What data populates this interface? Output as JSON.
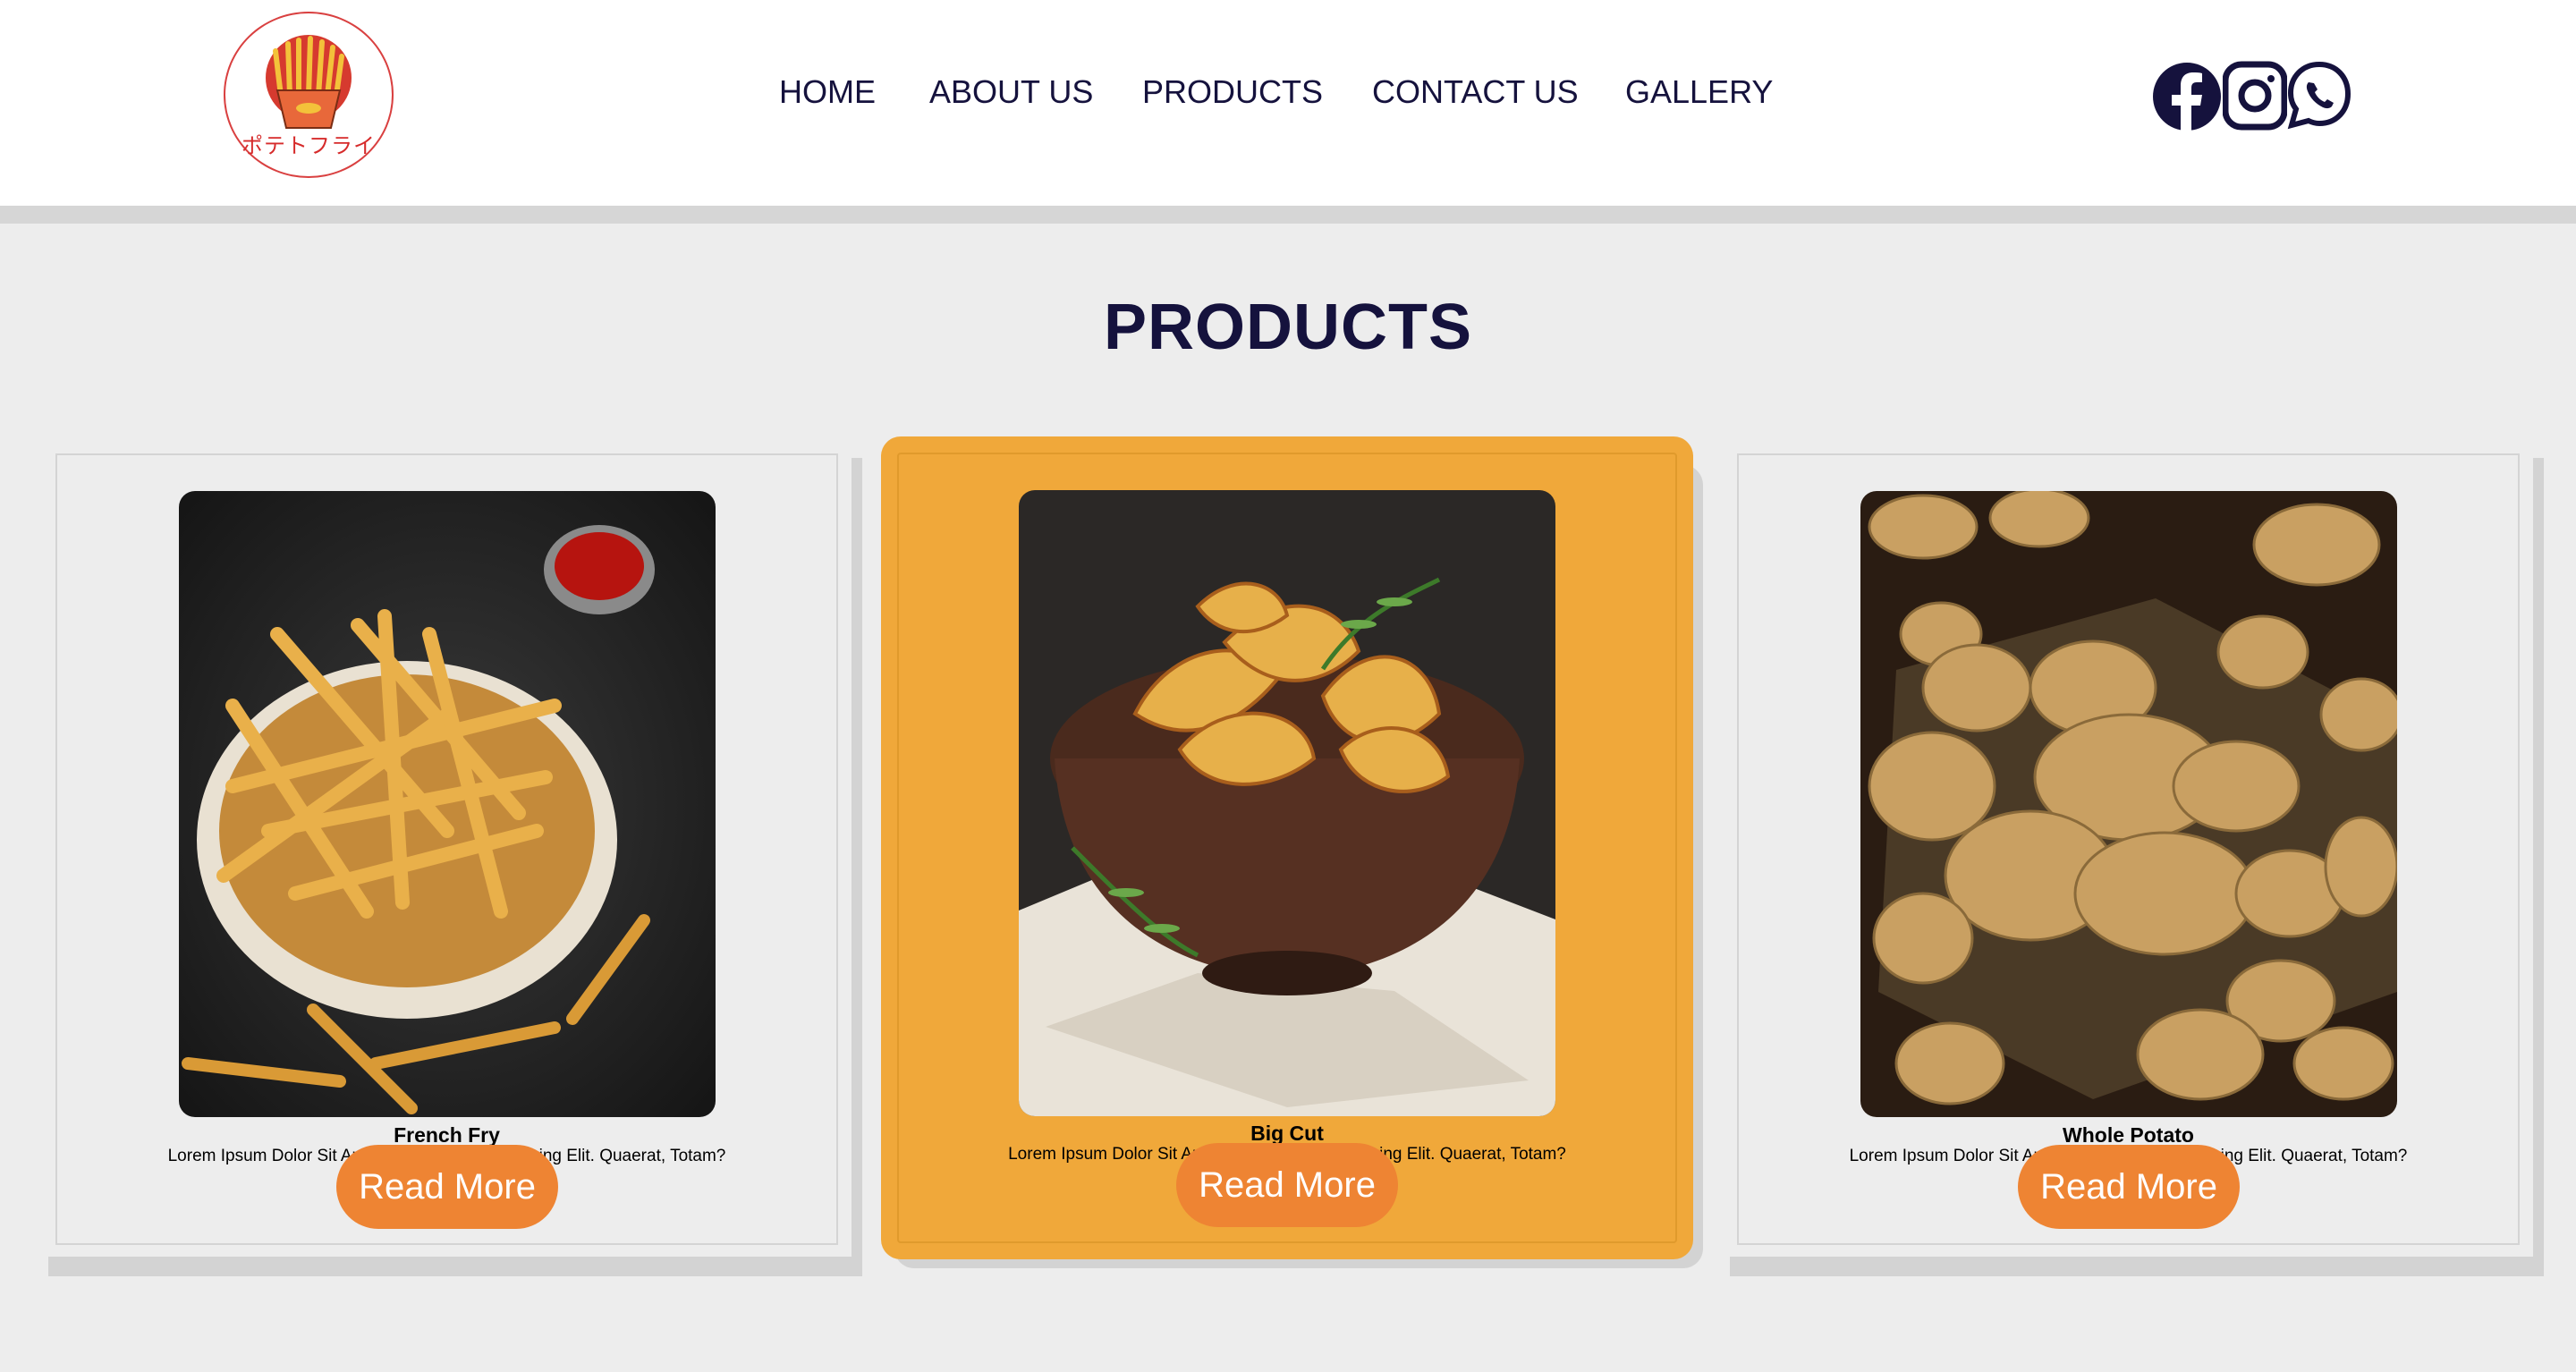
{
  "logo": {
    "text": "ポテトフライ",
    "icon": "french-fries-icon"
  },
  "nav": {
    "items": [
      {
        "label": "HOME"
      },
      {
        "label": "ABOUT US"
      },
      {
        "label": "PRODUCTS"
      },
      {
        "label": "CONTACT US"
      },
      {
        "label": "GALLERY"
      }
    ]
  },
  "social": {
    "icons": [
      "facebook-icon",
      "instagram-icon",
      "whatsapp-icon"
    ]
  },
  "main": {
    "title": "PRODUCTS",
    "cards": [
      {
        "name": "French Fry",
        "description": "Lorem Ipsum Dolor Sit Amet Consectetur Adipisicing Elit. Quaerat, Totam?",
        "button": "Read More",
        "image": "french-fries-photo"
      },
      {
        "name": "Big Cut",
        "description": "Lorem Ipsum Dolor Sit Amet Consectetur Adipisicing Elit. Quaerat, Totam?",
        "button": "Read More",
        "image": "potato-wedges-photo",
        "highlighted": true
      },
      {
        "name": "Whole Potato",
        "description": "Lorem Ipsum Dolor Sit Amet Consectetur Adipisicing Elit. Quaerat, Totam?",
        "button": "Read More",
        "image": "whole-potatoes-photo"
      }
    ]
  },
  "colors": {
    "navy": "#15123d",
    "accent_orange": "#f0a83a",
    "button_orange": "#ee8433",
    "background": "#ededed",
    "logo_red": "#d62b2b"
  }
}
